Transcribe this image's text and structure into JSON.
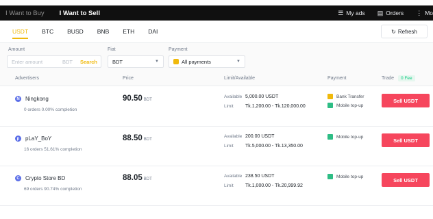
{
  "topbar": {
    "tabs": [
      "I Want to Buy",
      "I Want to Sell"
    ],
    "links": [
      {
        "icon": "sliders-icon",
        "glyph": "☰",
        "label": "My ads"
      },
      {
        "icon": "document-icon",
        "glyph": "▤",
        "label": "Orders"
      },
      {
        "icon": "more-icon",
        "glyph": "⋮",
        "label": "Mo"
      }
    ]
  },
  "crypto_tabs": [
    "USDT",
    "BTC",
    "BUSD",
    "BNB",
    "ETH",
    "DAI"
  ],
  "refresh": {
    "glyph": "↻",
    "label": "Refresh"
  },
  "filters": {
    "amount": {
      "label": "Amount",
      "placeholder": "Enter amount",
      "unit": "BDT",
      "search": "Search"
    },
    "fiat": {
      "label": "Fiat",
      "value": "BDT"
    },
    "payment": {
      "label": "Payment",
      "value": "All payments"
    }
  },
  "table_header": {
    "advertisers": "Advertisers",
    "price": "Price",
    "limit": "Limit/Available",
    "payment": "Payment",
    "trade": "Trade",
    "fee": "0 Fee"
  },
  "rows": [
    {
      "initial": "N",
      "name": "Ningkong",
      "stats": "0 orders   0.00% completion",
      "price": "90.50",
      "currency": "BDT",
      "available_label": "Available",
      "available": "5,000.00 USDT",
      "limit_label": "Limit",
      "limit": "Tk.1,200.00 - Tk.120,000.00",
      "payments": [
        "Bank Transfer",
        "Mobile top-up"
      ],
      "action": "Sell USDT"
    },
    {
      "initial": "p",
      "name": "pLaY_BoY",
      "stats": "16 orders   51.61% completion",
      "price": "88.50",
      "currency": "BDT",
      "available_label": "Available",
      "available": "200.00 USDT",
      "limit_label": "Limit",
      "limit": "Tk.5,000.00 - Tk.13,350.00",
      "payments": [
        "Mobile top-up"
      ],
      "action": "Sell USDT"
    },
    {
      "initial": "C",
      "name": "Crypto Store BD",
      "stats": "69 orders   90.74% completion",
      "price": "88.05",
      "currency": "BDT",
      "available_label": "Available",
      "available": "238.50 USDT",
      "limit_label": "Limit",
      "limit": "Tk.1,000.00 - Tk.20,999.92",
      "payments": [
        "Mobile top-up"
      ],
      "action": "Sell USDT"
    }
  ],
  "colors": {
    "accent": "#f0b90b",
    "sell": "#f6465d",
    "fee": "#0ecb81",
    "topbar": "#101010"
  }
}
